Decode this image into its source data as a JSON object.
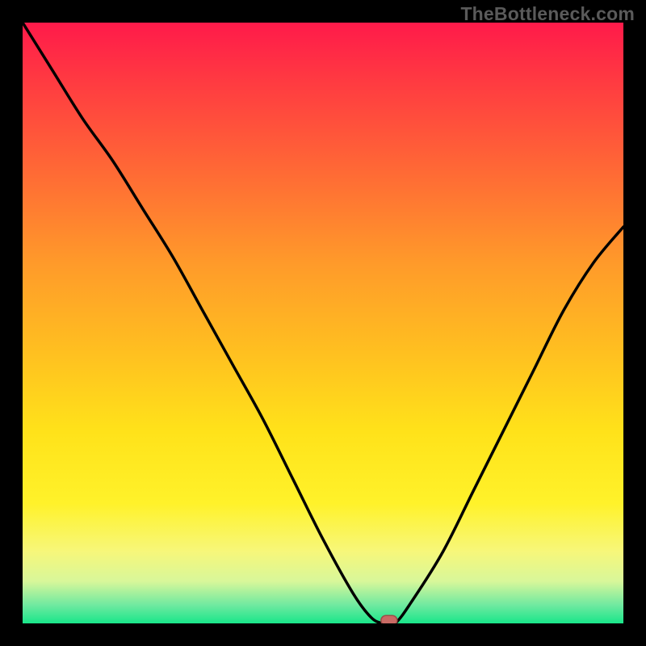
{
  "watermark": "TheBottleneck.com",
  "chart_data": {
    "type": "line",
    "title": "",
    "xlabel": "",
    "ylabel": "",
    "xlim": [
      0,
      100
    ],
    "ylim": [
      0,
      100
    ],
    "series": [
      {
        "name": "bottleneck_curve",
        "x": [
          0,
          5,
          10,
          15,
          20,
          25,
          30,
          35,
          40,
          45,
          50,
          55,
          58,
          60,
          62,
          65,
          70,
          75,
          80,
          85,
          90,
          95,
          100
        ],
        "values": [
          100,
          92,
          84,
          77,
          69,
          61,
          52,
          43,
          34,
          24,
          14,
          5,
          1,
          0,
          0,
          4,
          12,
          22,
          32,
          42,
          52,
          60,
          66
        ]
      }
    ],
    "marker": {
      "x": 61,
      "y": 0.5
    },
    "background_gradient": {
      "stops": [
        {
          "offset": 0.0,
          "color": "#ff1a4a"
        },
        {
          "offset": 0.1,
          "color": "#ff3b41"
        },
        {
          "offset": 0.25,
          "color": "#ff6a35"
        },
        {
          "offset": 0.4,
          "color": "#ff9a2a"
        },
        {
          "offset": 0.55,
          "color": "#ffc020"
        },
        {
          "offset": 0.68,
          "color": "#ffe21a"
        },
        {
          "offset": 0.8,
          "color": "#fff22a"
        },
        {
          "offset": 0.88,
          "color": "#f7f77a"
        },
        {
          "offset": 0.93,
          "color": "#d8f79a"
        },
        {
          "offset": 0.97,
          "color": "#6ee9a0"
        },
        {
          "offset": 1.0,
          "color": "#19e68a"
        }
      ]
    },
    "curve_color": "#000000",
    "curve_width": 3.5,
    "marker_fill": "#c96a64",
    "marker_stroke": "#9e4d47"
  }
}
